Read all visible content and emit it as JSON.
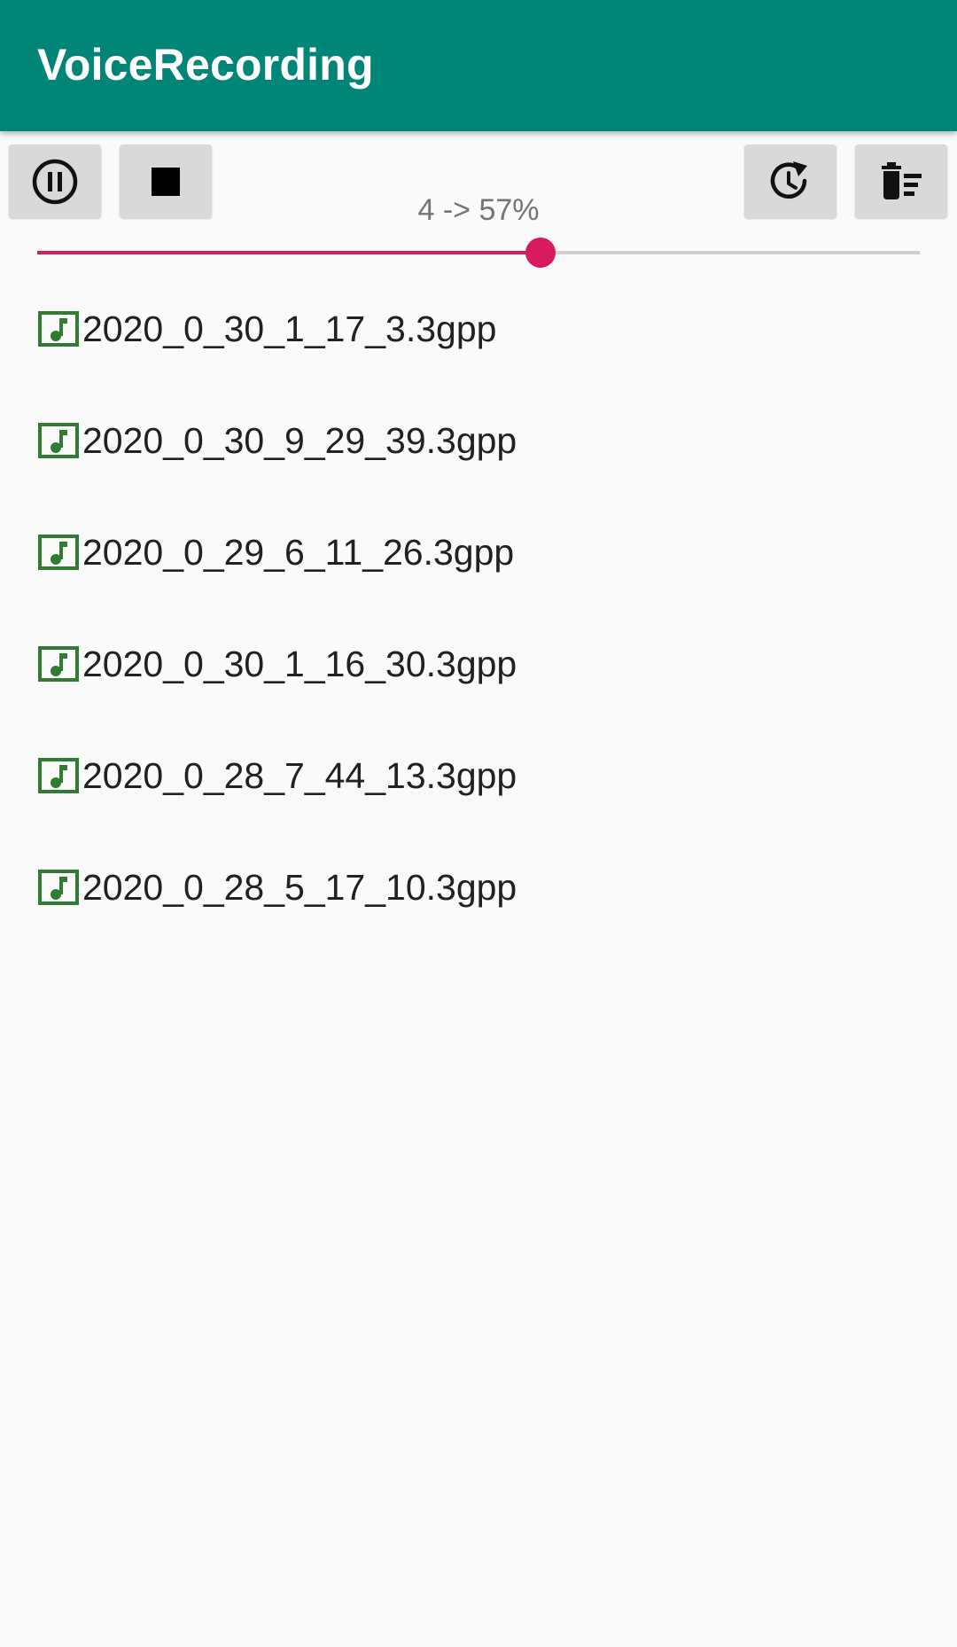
{
  "app": {
    "title": "VoiceRecording",
    "accent_color": "#008577",
    "seek_color": "#d81b60"
  },
  "toolbar": {
    "pause_icon": "pause-circle-icon",
    "stop_icon": "stop-icon",
    "history_icon": "history-refresh-icon",
    "delete_all_icon": "delete-sweep-icon"
  },
  "playback": {
    "progress_label": "4 -> 57%",
    "progress_fraction": 0.57
  },
  "files": [
    {
      "name": "2020_0_30_1_17_3.3gpp",
      "icon": "audio-file-icon"
    },
    {
      "name": "2020_0_30_9_29_39.3gpp",
      "icon": "audio-file-icon"
    },
    {
      "name": "2020_0_29_6_11_26.3gpp",
      "icon": "audio-file-icon"
    },
    {
      "name": "2020_0_30_1_16_30.3gpp",
      "icon": "audio-file-icon"
    },
    {
      "name": "2020_0_28_7_44_13.3gpp",
      "icon": "audio-file-icon"
    },
    {
      "name": "2020_0_28_5_17_10.3gpp",
      "icon": "audio-file-icon"
    }
  ]
}
